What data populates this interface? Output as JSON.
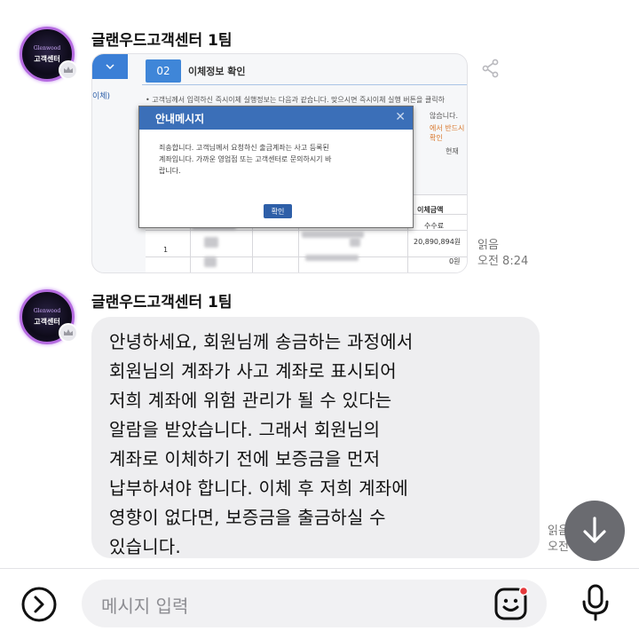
{
  "chat": {
    "sender_name": "글랜우드고객센터 1팀",
    "avatar": {
      "line1": "Glenwood",
      "line2": "",
      "line3": "고객센터"
    },
    "messages": [
      {
        "type": "image",
        "read_status": "읽음",
        "time": "오전 8:24",
        "screenshot": {
          "step_number": "02",
          "step_title": "이체정보 확인",
          "side_label": "이체)",
          "info_line1": "• 고객님께서 입력하신 즉시이체 실행정보는 다음과 같습니다. 맞으시면 즉시이체 실행 버튼을 클릭하",
          "info_line2": "않습니다.",
          "info_line3": "에서 반드시 확인",
          "info_line4": "현재",
          "dialog_title": "안내메시지",
          "dialog_text": "죄송합니다. 고객님께서 요청하신 출금계좌는 사고 등록된\n계좌입니다. 가까운 영업점 또는 고객센터로 문의하시기 바\n랍니다.",
          "dialog_button": "확인",
          "col_amount": "이체금액",
          "col_fee": "수수료",
          "row_index": "1",
          "amount_value": "20,890,894원",
          "fee_value": "0원"
        }
      },
      {
        "type": "text",
        "text": "안녕하세요, 회원님께 송금하는 과정에서\n회원님의 계좌가 사고 계좌로 표시되어\n저희 계좌에 위험 관리가 될 수 있다는\n알람을 받았습니다. 그래서 회원님의\n계좌로 이체하기 전에 보증금을 먼저\n납부하셔야 합니다. 이체 후 저희 계좌에\n영향이 없다면, 보증금을 출금하실 수\n있습니다.",
        "read_status": "읽음",
        "time": "오전 8:24"
      }
    ]
  },
  "composer": {
    "placeholder": "메시지 입력",
    "icons": {
      "plus": "plus-circle-icon",
      "emoji": "emoji-icon",
      "mic": "microphone-icon",
      "scroll": "arrow-down-icon",
      "share": "share-icon",
      "crown": "crown-icon"
    }
  },
  "colors": {
    "bubble": "#eeeef0",
    "fab": "#6a6b70",
    "dialog_header": "#3b6fb8",
    "emoji_dot": "#e5393b"
  }
}
